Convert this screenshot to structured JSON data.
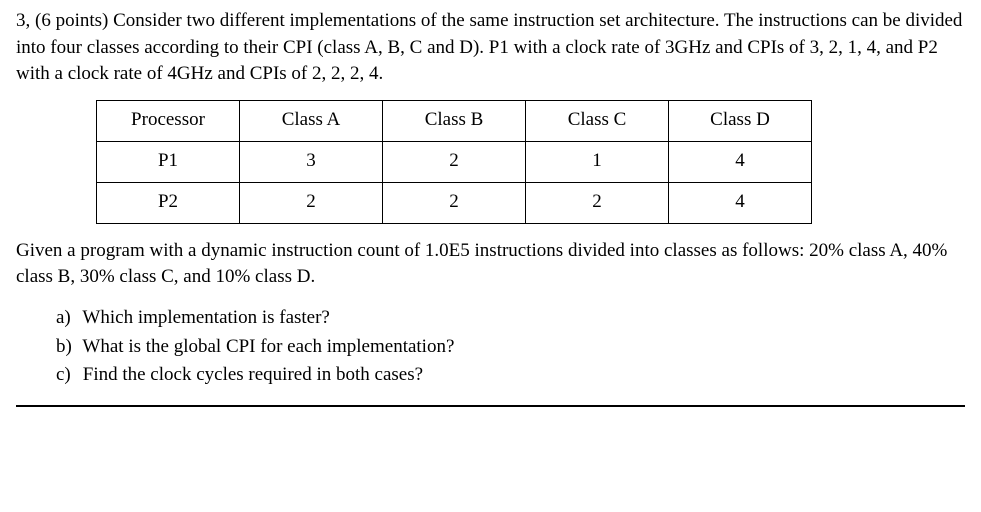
{
  "problem": {
    "number_points": "3, (6 points)",
    "intro": "Consider two different implementations of the same instruction set architecture. The instructions can be divided into four classes according to their CPI (class A, B, C and D). P1 with a clock rate of 3GHz and CPIs of 3, 2, 1, 4, and P2 with a clock rate of 4GHz and CPIs of 2, 2, 2, 4."
  },
  "table": {
    "headers": [
      "Processor",
      "Class A",
      "Class B",
      "Class C",
      "Class D"
    ],
    "rows": [
      {
        "processor": "P1",
        "a": "3",
        "b": "2",
        "c": "1",
        "d": "4"
      },
      {
        "processor": "P2",
        "a": "2",
        "b": "2",
        "c": "2",
        "d": "4"
      }
    ]
  },
  "given": "Given a program with a dynamic instruction count of 1.0E5 instructions divided into classes as follows: 20% class A, 40% class B, 30% class C, and 10% class D.",
  "subparts": {
    "a": {
      "label": "a)",
      "text": "Which implementation is faster?"
    },
    "b": {
      "label": "b)",
      "text": "What is the global CPI for each implementation?"
    },
    "c": {
      "label": "c)",
      "text": "Find the clock cycles required in both cases?"
    }
  },
  "chart_data": {
    "type": "table",
    "title": "CPI per class for two processors",
    "columns": [
      "Processor",
      "Class A",
      "Class B",
      "Class C",
      "Class D"
    ],
    "rows": [
      [
        "P1",
        3,
        2,
        1,
        4
      ],
      [
        "P2",
        2,
        2,
        2,
        4
      ]
    ],
    "context": {
      "dynamic_instruction_count": 100000.0,
      "class_fractions": {
        "A": 0.2,
        "B": 0.4,
        "C": 0.3,
        "D": 0.1
      },
      "clock_rates_GHz": {
        "P1": 3,
        "P2": 4
      }
    }
  }
}
